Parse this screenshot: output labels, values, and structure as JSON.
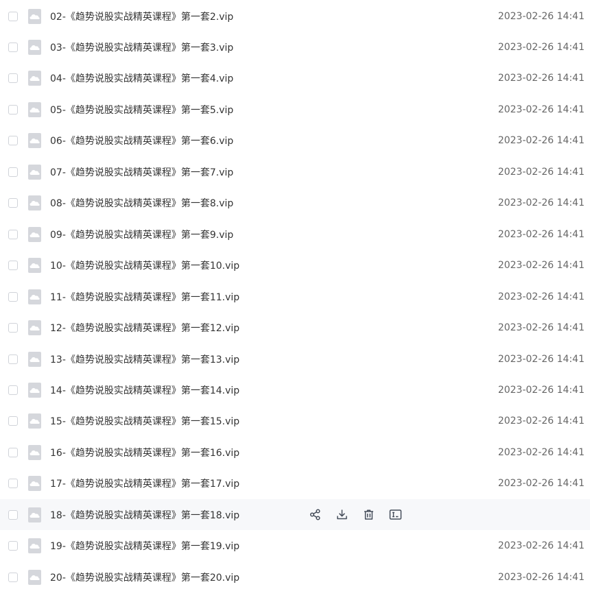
{
  "files": [
    {
      "name": "02-《趋势说股实战精英课程》第一套2.vip",
      "time": "2023-02-26 14:41"
    },
    {
      "name": "03-《趋势说股实战精英课程》第一套3.vip",
      "time": "2023-02-26 14:41"
    },
    {
      "name": "04-《趋势说股实战精英课程》第一套4.vip",
      "time": "2023-02-26 14:41"
    },
    {
      "name": "05-《趋势说股实战精英课程》第一套5.vip",
      "time": "2023-02-26 14:41"
    },
    {
      "name": "06-《趋势说股实战精英课程》第一套6.vip",
      "time": "2023-02-26 14:41"
    },
    {
      "name": "07-《趋势说股实战精英课程》第一套7.vip",
      "time": "2023-02-26 14:41"
    },
    {
      "name": "08-《趋势说股实战精英课程》第一套8.vip",
      "time": "2023-02-26 14:41"
    },
    {
      "name": "09-《趋势说股实战精英课程》第一套9.vip",
      "time": "2023-02-26 14:41"
    },
    {
      "name": "10-《趋势说股实战精英课程》第一套10.vip",
      "time": "2023-02-26 14:41"
    },
    {
      "name": "11-《趋势说股实战精英课程》第一套11.vip",
      "time": "2023-02-26 14:41"
    },
    {
      "name": "12-《趋势说股实战精英课程》第一套12.vip",
      "time": "2023-02-26 14:41"
    },
    {
      "name": "13-《趋势说股实战精英课程》第一套13.vip",
      "time": "2023-02-26 14:41"
    },
    {
      "name": "14-《趋势说股实战精英课程》第一套14.vip",
      "time": "2023-02-26 14:41"
    },
    {
      "name": "15-《趋势说股实战精英课程》第一套15.vip",
      "time": "2023-02-26 14:41"
    },
    {
      "name": "16-《趋势说股实战精英课程》第一套16.vip",
      "time": "2023-02-26 14:41"
    },
    {
      "name": "17-《趋势说股实战精英课程》第一套17.vip",
      "time": "2023-02-26 14:41"
    },
    {
      "name": "18-《趋势说股实战精英课程》第一套18.vip",
      "time": "",
      "hovered": true
    },
    {
      "name": "19-《趋势说股实战精英课程》第一套19.vip",
      "time": "2023-02-26 14:41"
    },
    {
      "name": "20-《趋势说股实战精英课程》第一套20.vip",
      "time": "2023-02-26 14:41"
    }
  ],
  "hover_actions": [
    {
      "name": "share-icon"
    },
    {
      "name": "download-icon"
    },
    {
      "name": "delete-icon"
    },
    {
      "name": "rename-icon"
    }
  ],
  "colors": {
    "hover_row_bg": "#f7f8fa",
    "file_name_text": "#333333",
    "time_text": "#666666",
    "file_icon": "#d5d7dc",
    "checkbox_border": "#d0d3d9",
    "action_icon": "#454d5a"
  }
}
